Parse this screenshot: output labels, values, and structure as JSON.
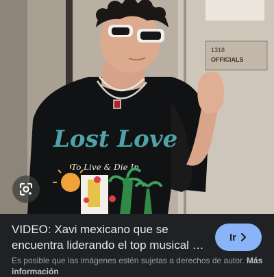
{
  "image": {
    "shirt_brand_text": "Lost Love",
    "shirt_tagline": "To Live & Die In",
    "room_sign_line1": "1318",
    "room_sign_line2": "OFFICIALS"
  },
  "lens_button": {
    "icon": "lens-icon"
  },
  "result": {
    "title": "VIDEO: Xavi mexicano que se encuentra liderando el top musical de las listas",
    "go_button_label": "Ir",
    "go_button_icon": "chevron-right-icon"
  },
  "notice": {
    "text": "Es posible que las imágenes estén sujetas a derechos de autor.",
    "more_link": "Más información"
  },
  "colors": {
    "background": "#202124",
    "accent": "#8ab4f8",
    "title_text": "#e8eaed",
    "secondary_text": "#9aa0a6"
  }
}
